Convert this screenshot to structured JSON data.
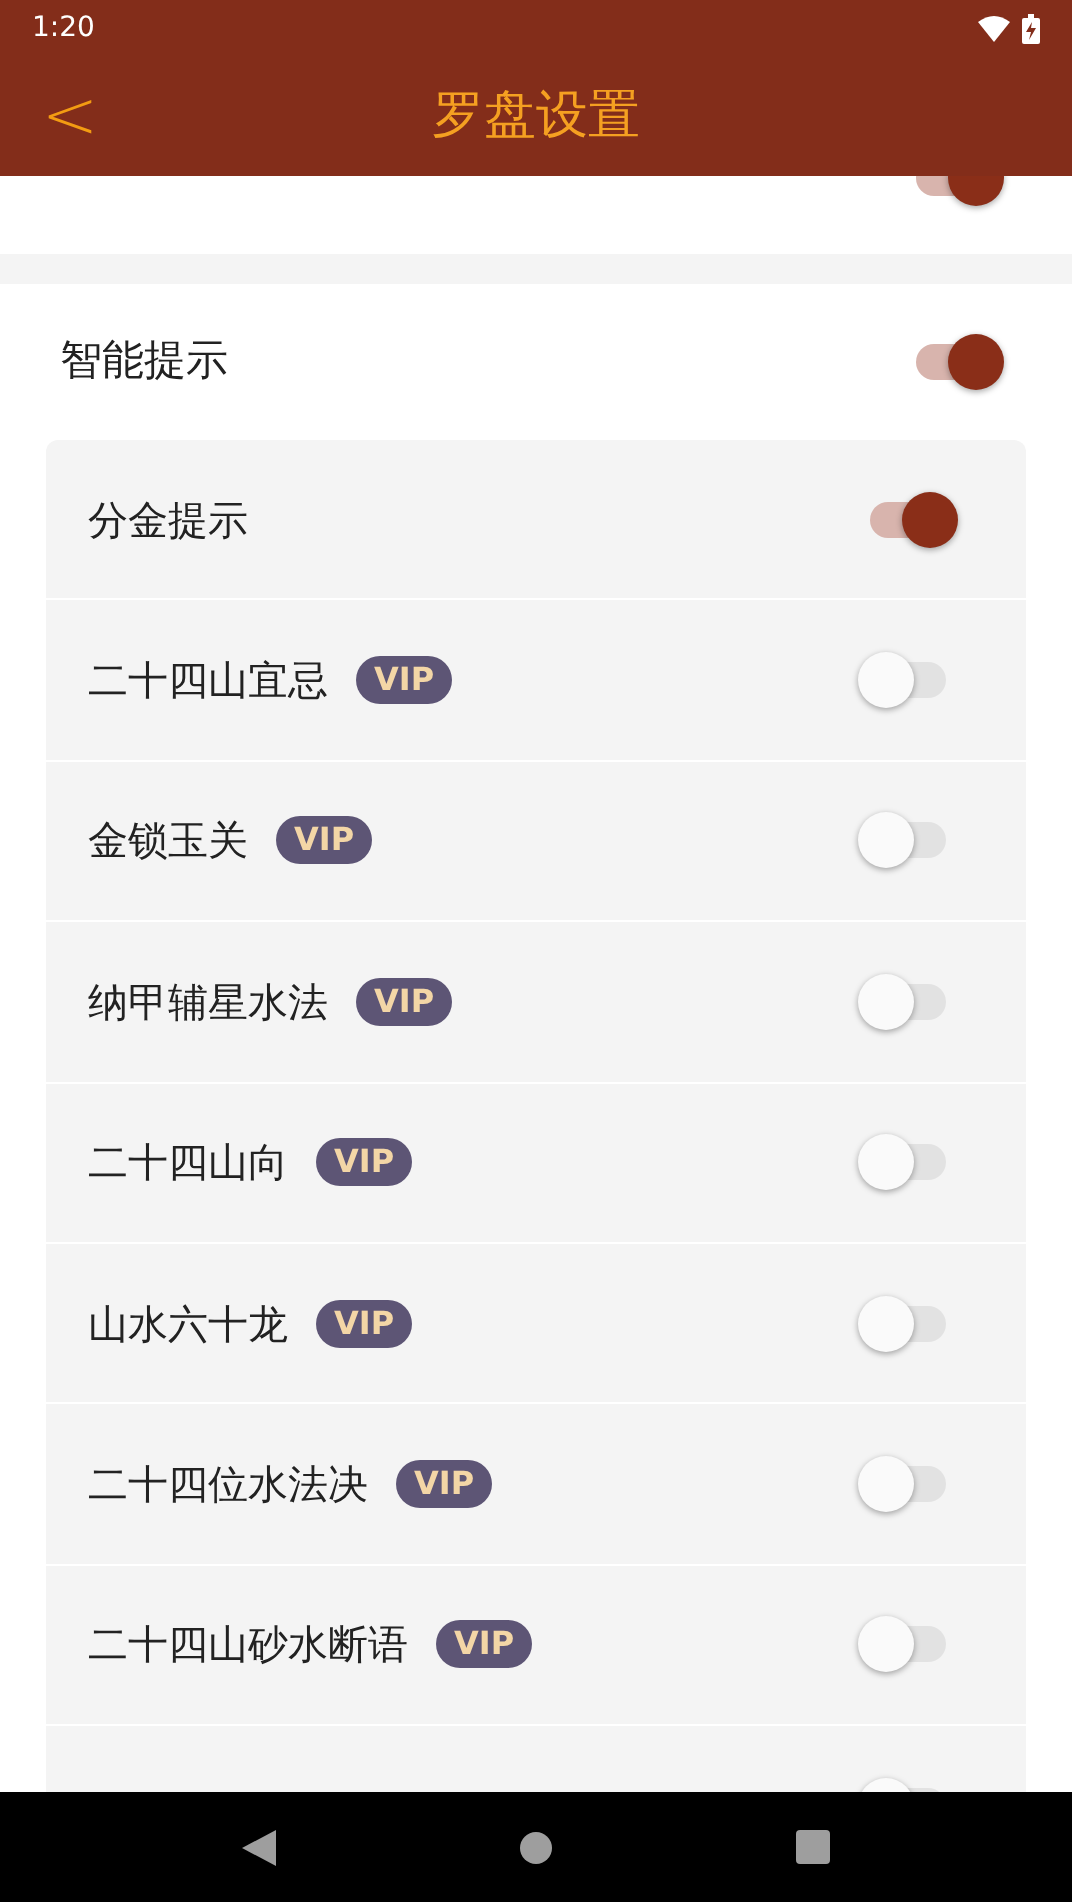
{
  "status_bar": {
    "time": "1:20"
  },
  "header": {
    "back": "<",
    "title": "罗盘设置"
  },
  "top_row": {
    "on": true
  },
  "main_toggle": {
    "label": "智能提示",
    "on": true
  },
  "items": [
    {
      "label": "分金提示",
      "on": true
    },
    {
      "label": "二十四山宜忌",
      "badge": "VIP",
      "on": false
    },
    {
      "label": "金锁玉关",
      "badge": "VIP",
      "on": false
    },
    {
      "label": "纳甲辅星水法",
      "badge": "VIP",
      "on": false
    },
    {
      "label": "二十四山向",
      "badge": "VIP",
      "on": false
    },
    {
      "label": "山水六十龙",
      "badge": "VIP",
      "on": false
    },
    {
      "label": "二十四位水法决",
      "badge": "VIP",
      "on": false
    },
    {
      "label": "二十四山砂水断语",
      "badge": "VIP",
      "on": false
    }
  ],
  "cut_row": {
    "on": false
  }
}
